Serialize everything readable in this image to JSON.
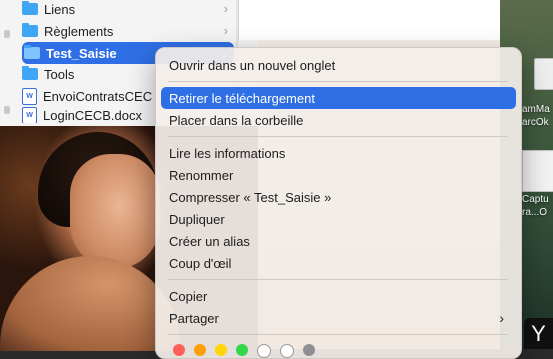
{
  "finder": {
    "rows": [
      {
        "label": "Liens",
        "kind": "folder"
      },
      {
        "label": "Règlements",
        "kind": "folder"
      },
      {
        "label": "Test_Saisie",
        "kind": "folder",
        "selected": true
      },
      {
        "label": "Tools",
        "kind": "folder"
      },
      {
        "label": "EnvoiContratsCEC",
        "kind": "doc",
        "doc_icon_text": "W"
      },
      {
        "label": "LoginCECB.docx",
        "kind": "doc",
        "doc_icon_text": "W"
      }
    ],
    "chevron": "›"
  },
  "desktop": {
    "icon1_label_line1": "amMa",
    "icon1_label_line2": "arcOk",
    "icon2_label_line1": "Captu",
    "icon2_label_line2": "ra...O",
    "badge_text": "Y"
  },
  "context_menu": {
    "items": [
      "Ouvrir dans un nouvel onglet",
      "Retirer le téléchargement",
      "Placer dans la corbeille",
      "Lire les informations",
      "Renommer",
      "Compresser « Test_Saisie »",
      "Dupliquer",
      "Créer un alias",
      "Coup d'œil",
      "Copier",
      "Partager"
    ],
    "highlighted_index": 1,
    "submenu_arrow": "›",
    "tag_colors": [
      "#ff5f57",
      "#ff9f0a",
      "#ffd60a",
      "#32d74b",
      "#ffffff",
      "#ffffff",
      "#8e8e93"
    ]
  },
  "colors": {
    "accent": "#2f6fe5",
    "folder": "#3fa5f5"
  }
}
